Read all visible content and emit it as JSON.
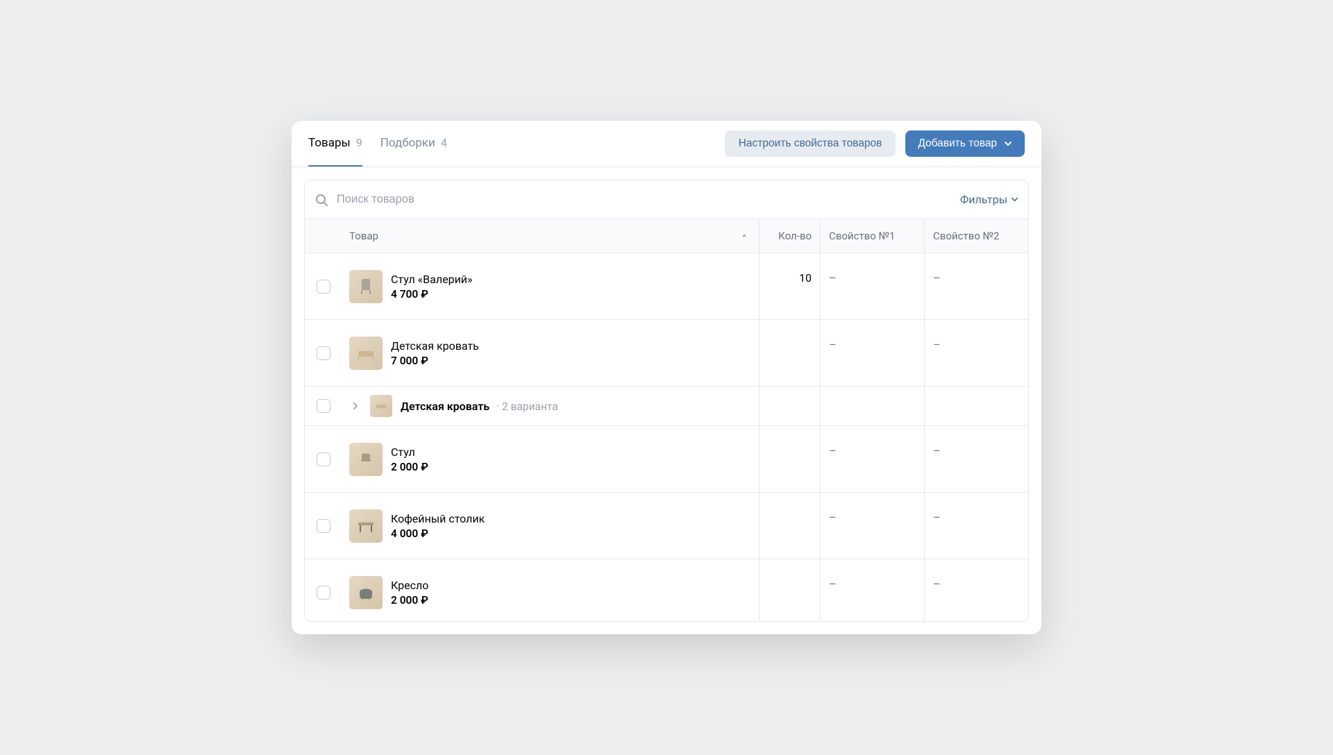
{
  "tabs": [
    {
      "label": "Товары",
      "count": "9",
      "active": true
    },
    {
      "label": "Подборки",
      "count": "4",
      "active": false
    }
  ],
  "actions": {
    "settings": "Настроить свойства товаров",
    "add": "Добавить товар"
  },
  "search": {
    "placeholder": "Поиск товаров",
    "filters": "Фильтры"
  },
  "columns": {
    "product": "Товар",
    "qty": "Кол-во",
    "prop1": "Свойство №1",
    "prop2": "Свойство №2"
  },
  "rows": [
    {
      "type": "item",
      "name": "Стул «Валерий»",
      "price": "4 700 ₽",
      "qty": "10",
      "prop1": "–",
      "prop2": "–"
    },
    {
      "type": "item",
      "name": "Детская кровать",
      "price": "7 000 ₽",
      "qty": "",
      "prop1": "–",
      "prop2": "–"
    },
    {
      "type": "variant-group",
      "name": "Детская кровать",
      "meta": "· 2 варианта"
    },
    {
      "type": "item",
      "name": "Стул",
      "price": "2 000 ₽",
      "qty": "",
      "prop1": "–",
      "prop2": "–"
    },
    {
      "type": "item",
      "name": "Кофейный столик",
      "price": "4 000 ₽",
      "qty": "",
      "prop1": "–",
      "prop2": "–"
    },
    {
      "type": "item",
      "name": "Кресло",
      "price": "2 000 ₽",
      "qty": "",
      "prop1": "–",
      "prop2": "–"
    }
  ]
}
